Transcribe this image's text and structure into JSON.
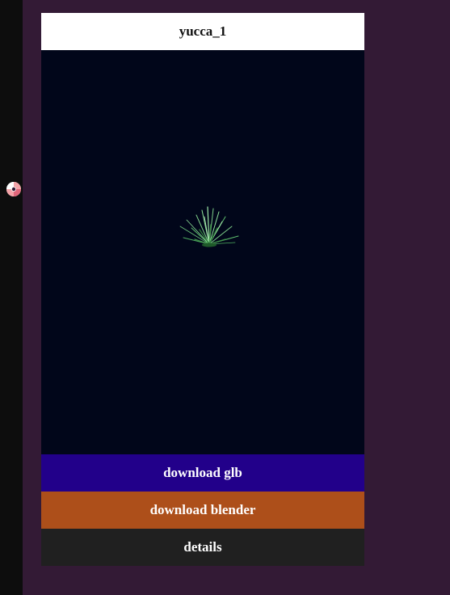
{
  "brand": {
    "logo_icon": "swirl-logo-icon",
    "colors": [
      "#f4a3a8",
      "#ffffff",
      "#e0667a"
    ]
  },
  "card": {
    "title": "yucca_1",
    "viewer": {
      "model_icon": "yucca-plant-model",
      "background": "#01061a"
    },
    "buttons": {
      "download_glb": "download glb",
      "download_blender": "download blender",
      "details": "details"
    }
  },
  "colors": {
    "page_background": "#331a35",
    "sidebar": "#0d0d0d",
    "glb_button": "#22008a",
    "blender_button": "#ad4f1a",
    "details_button": "#202020"
  }
}
